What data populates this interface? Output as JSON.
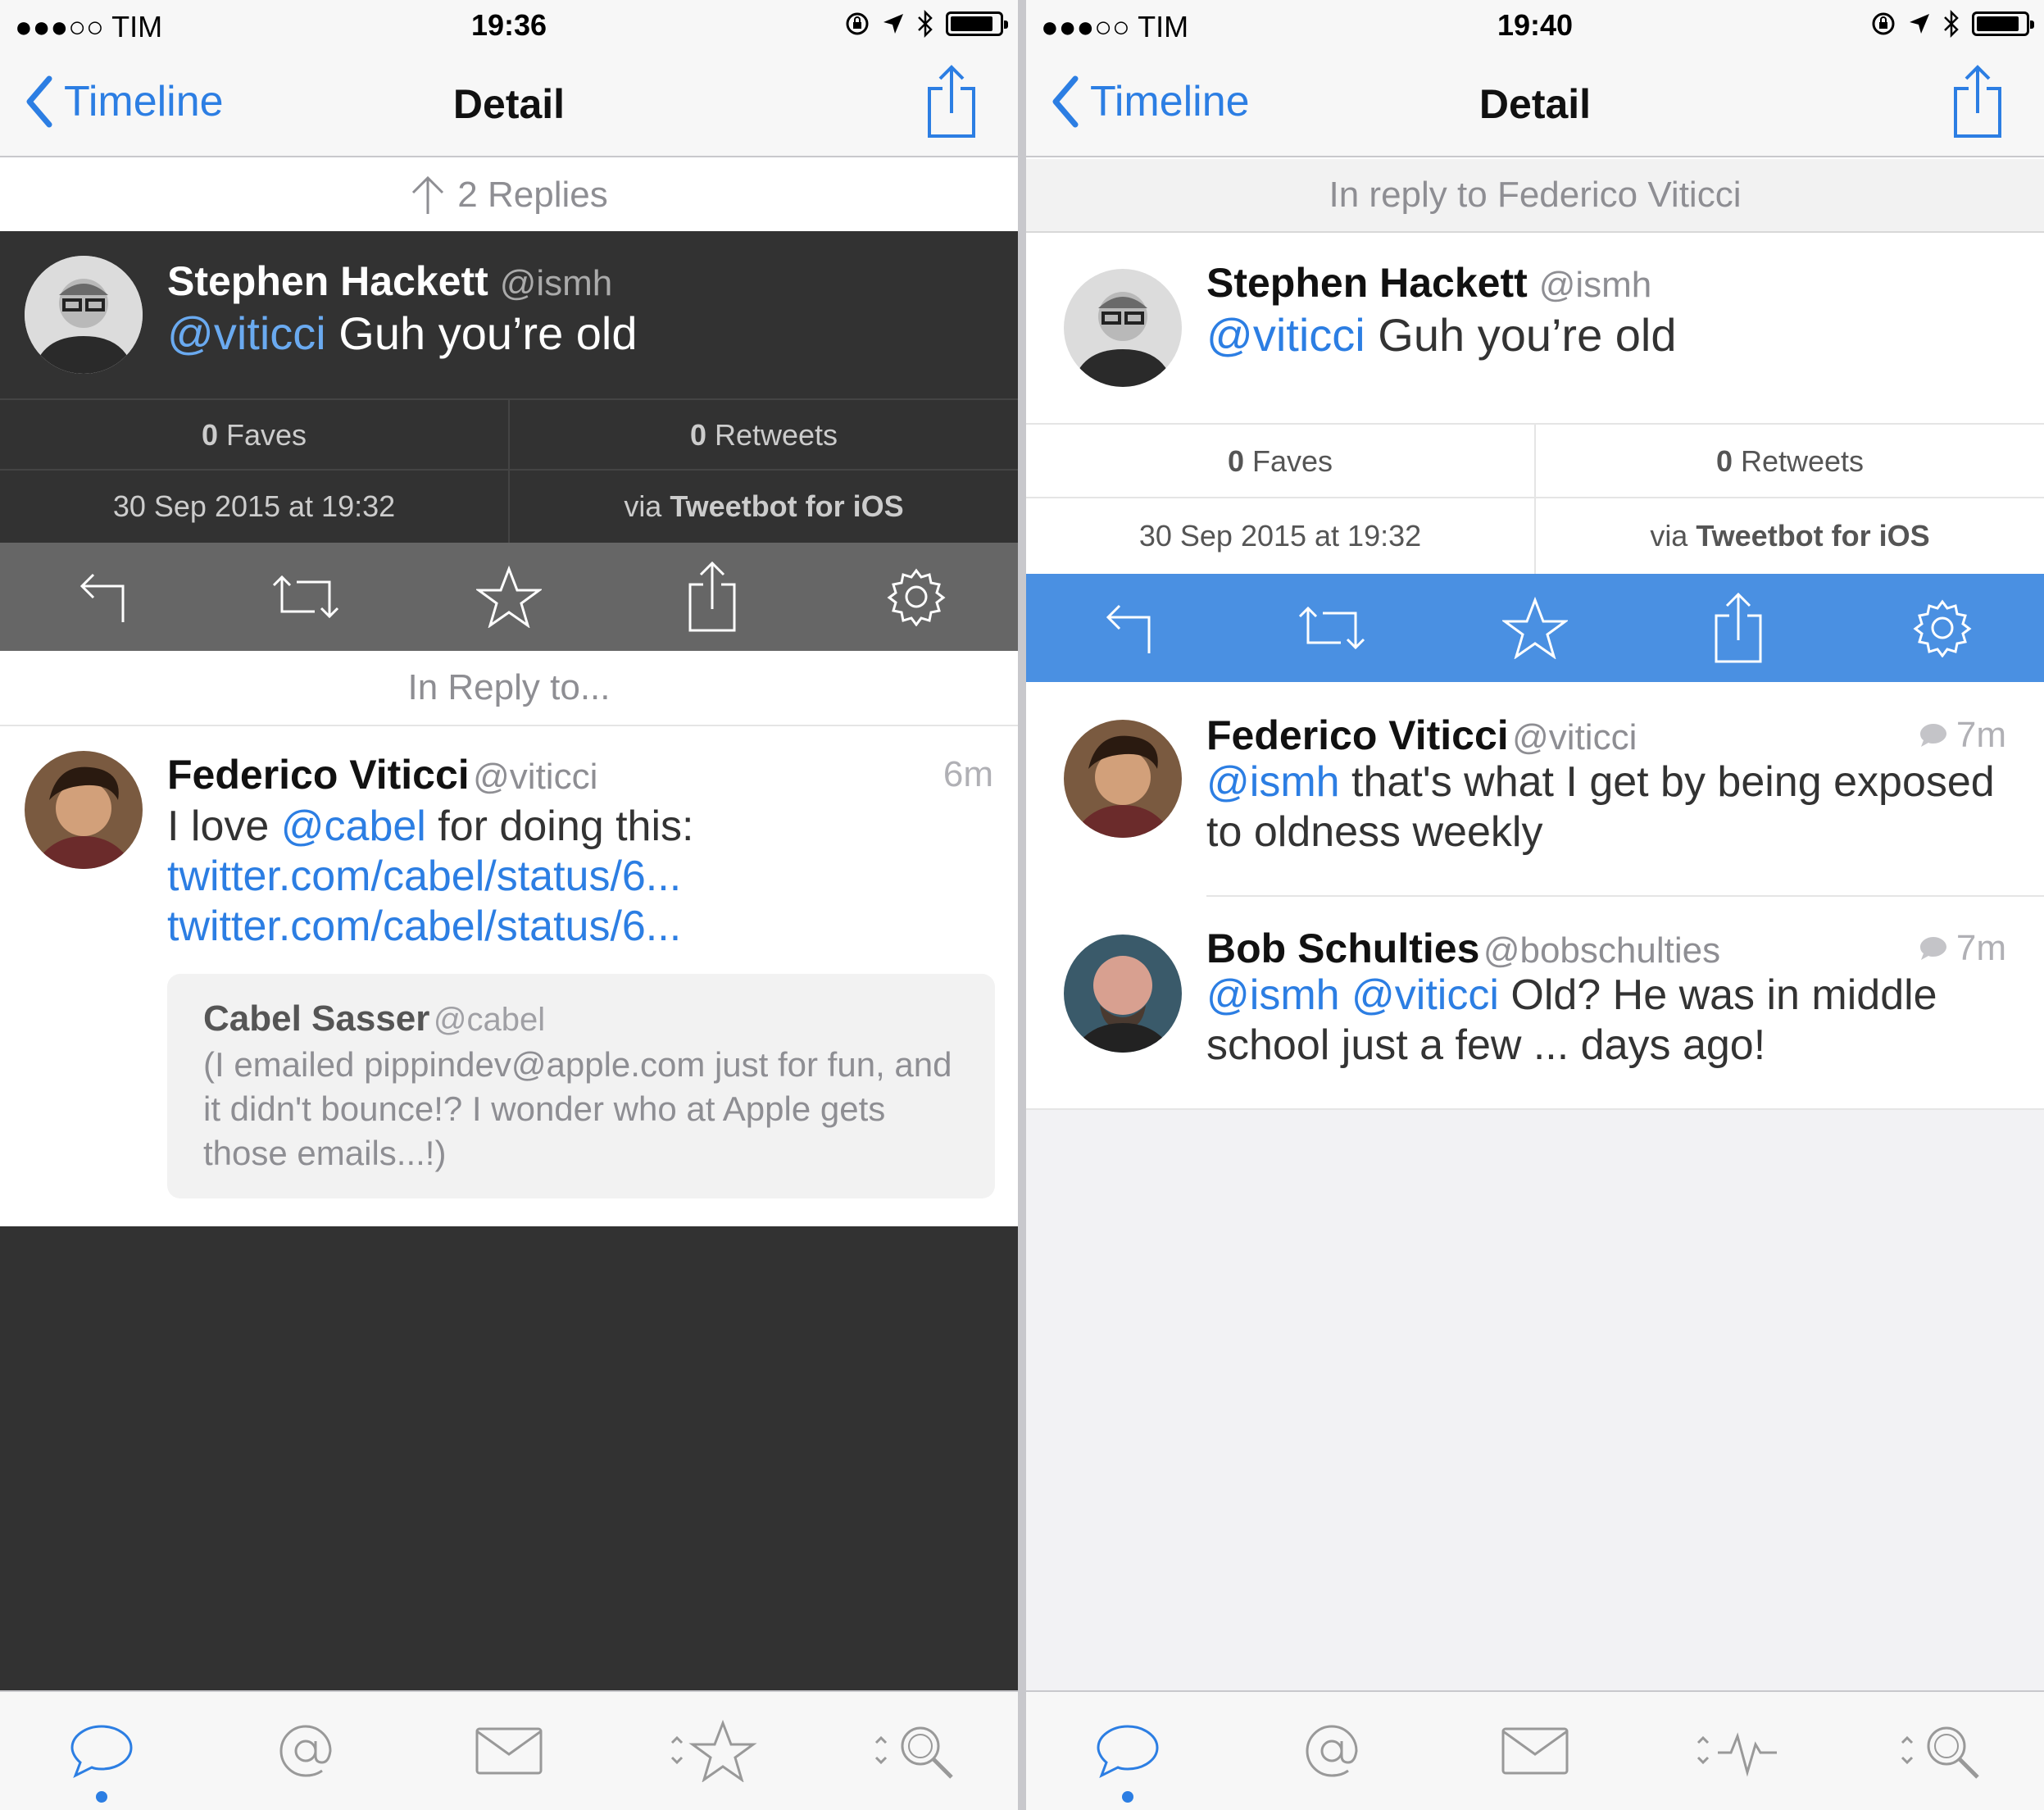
{
  "left": {
    "status": {
      "carrier": "●●●○○ TIM",
      "time": "19:36"
    },
    "nav": {
      "back": "Timeline",
      "title": "Detail"
    },
    "replies_header": "2 Replies",
    "tweet": {
      "name": "Stephen Hackett",
      "handle": "@ismh",
      "mention": "@viticci",
      "text": " Guh you’re old",
      "faves_count": "0",
      "faves_label": " Faves",
      "retweets_count": "0",
      "retweets_label": " Retweets",
      "date": "30 Sep 2015 at 19:32",
      "via_prefix": "via ",
      "via_app": "Tweetbot for iOS"
    },
    "in_reply_header": "In Reply to...",
    "reply": {
      "name": "Federico Viticci",
      "handle": "@viticci",
      "time": "6m",
      "text_prefix": "I love ",
      "mention": "@cabel",
      "text_mid": " for doing this: ",
      "link1": "twitter.com/cabel/status/6...",
      "link2": "twitter.com/cabel/status/6...",
      "quote": {
        "name": "Cabel Sasser",
        "handle": "@cabel",
        "text": "(I emailed pippindev@apple.com just for fun, and it didn't bounce!? I wonder who at Apple gets those emails...!)"
      }
    },
    "colors": {
      "dark_bg": "#323232",
      "actionbar": "#666666"
    }
  },
  "right": {
    "status": {
      "carrier": "●●●○○ TIM",
      "time": "19:40"
    },
    "nav": {
      "back": "Timeline",
      "title": "Detail"
    },
    "in_reply_header": "In reply to Federico Viticci",
    "tweet": {
      "name": "Stephen Hackett",
      "handle": "@ismh",
      "mention": "@viticci",
      "text": " Guh you’re old",
      "faves_count": "0",
      "faves_label": " Faves",
      "retweets_count": "0",
      "retweets_label": " Retweets",
      "date": "30 Sep 2015 at 19:32",
      "via_prefix": "via ",
      "via_app": "Tweetbot for iOS"
    },
    "replies": [
      {
        "name": "Federico Viticci",
        "handle": "@viticci",
        "time": "7m",
        "mentions": "@ismh",
        "text": " that's what I get by being exposed to oldness weekly"
      },
      {
        "name": "Bob Schulties",
        "handle": "@bobschulties",
        "time": "7m",
        "mentions": "@ismh @viticci",
        "text": " Old? He was in middle school just a few ... days ago!"
      }
    ],
    "colors": {
      "actionbar": "#4a90e2",
      "accent": "#2c7ee3"
    }
  },
  "tabs_left": [
    "chat-bubble-icon",
    "at-icon",
    "mail-icon",
    "favorites-icon",
    "search-icon"
  ],
  "tabs_right": [
    "chat-bubble-icon",
    "at-icon",
    "mail-icon",
    "activity-icon",
    "search-icon"
  ]
}
